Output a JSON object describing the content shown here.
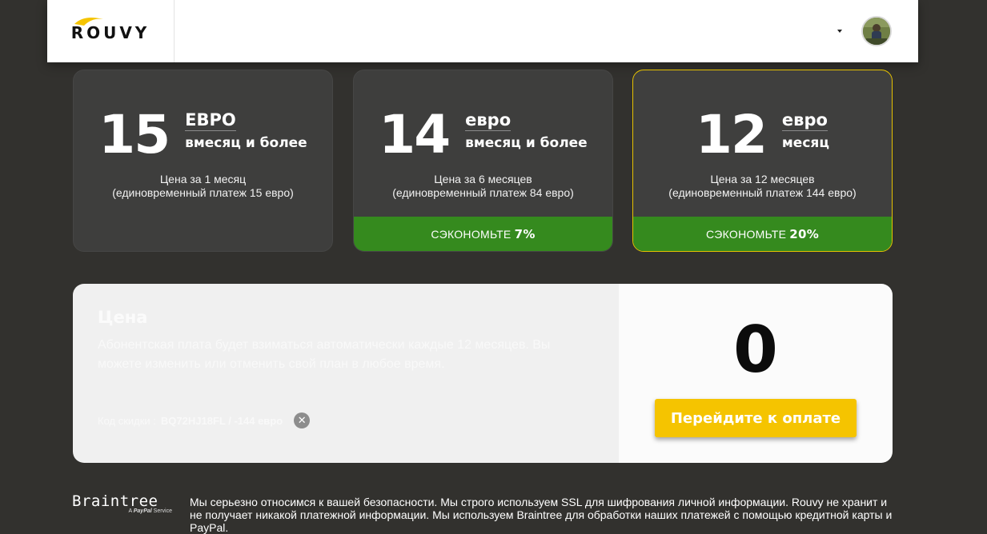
{
  "header": {
    "logo": "ROUVY",
    "menu_caret": "caret-down"
  },
  "plans": [
    {
      "price": "15",
      "currency": "ЕВРО",
      "period": "вмесяц и более",
      "desc_line1": "Цена за 1 месяц",
      "desc_line2": "(единовременный платеж 15 евро)",
      "savings_label": "",
      "savings_value": ""
    },
    {
      "price": "14",
      "currency": "евро",
      "period": "вмесяц и более",
      "desc_line1": "Цена за 6 месяцев",
      "desc_line2": "(единовременный платеж 84 евро)",
      "savings_label": "СЭКОНОМЬТЕ",
      "savings_value": "7%"
    },
    {
      "price": "12",
      "currency": "евро",
      "period": "месяц",
      "desc_line1": "Цена за 12 месяцев",
      "desc_line2": "(единовременный платеж 144 евро)",
      "savings_label": "СЭКОНОМЬТЕ",
      "savings_value": "20%",
      "selected": true
    }
  ],
  "summary": {
    "title": "Цена",
    "text": "Абонентская плата будет взиматься автоматически каждые 12 месяцев. Вы можете изменить или отменить свой план в любое время.",
    "discount_label": "Код скидки :",
    "discount_value": "BQ72HJ18FL / -144 евро",
    "total": "0",
    "pay_button": "Перейдите к оплате"
  },
  "footer": {
    "braintree_name": "Braintree",
    "braintree_sub_prefix": "A",
    "braintree_sub_brand": "PayPal",
    "braintree_sub_suffix": "Service",
    "security_text": "Мы серьезно относимся к вашей безопасности. Мы строго используем SSL для шифрования личной информации. Rouvy не хранит и не получает никакой платежной информации. Мы используем Braintree для обработки наших платежей с помощью кредитной карты и PayPal."
  },
  "colors": {
    "background": "#32312e",
    "accent_yellow": "#f5c400",
    "savings_green": "#358a1e",
    "card": "#3e3e3d"
  }
}
